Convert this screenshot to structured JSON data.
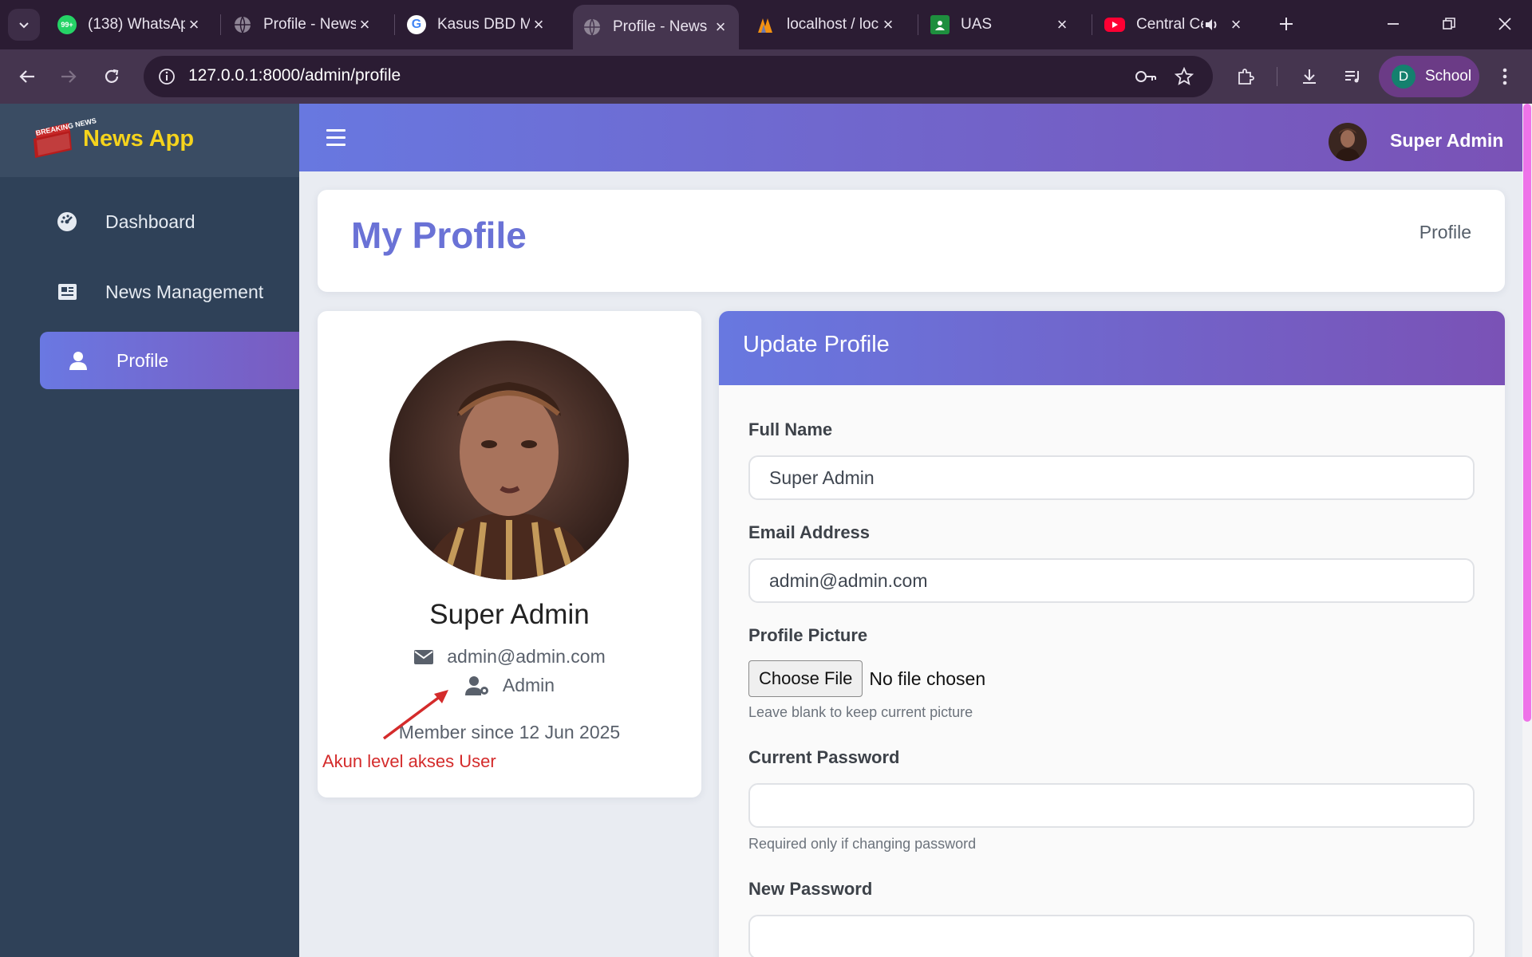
{
  "browser": {
    "tabs": [
      {
        "title": "(138) WhatsAp",
        "favicon": "whatsapp-icon",
        "badge": "99+"
      },
      {
        "title": "Profile - News",
        "favicon": "globe-icon"
      },
      {
        "title": "Kasus DBD Me",
        "favicon": "google-icon"
      },
      {
        "title": "Profile - News",
        "favicon": "globe-icon",
        "active": true
      },
      {
        "title": "localhost / loc",
        "favicon": "phpmyadmin-icon"
      },
      {
        "title": "UAS",
        "favicon": "classroom-icon"
      },
      {
        "title": "Central Ce",
        "favicon": "youtube-icon",
        "audio": true
      }
    ],
    "url": "127.0.0.1:8000/admin/profile",
    "profile": {
      "initial": "D",
      "label": "School"
    }
  },
  "app": {
    "brand": {
      "logo_text": "BREAKING NEWS",
      "name": "News App"
    },
    "nav": [
      {
        "label": "Dashboard",
        "icon": "dashboard-icon"
      },
      {
        "label": "News Management",
        "icon": "newspaper-icon"
      },
      {
        "label": "Profile",
        "icon": "user-icon",
        "active": true
      }
    ],
    "topbar": {
      "user_name": "Super Admin"
    },
    "page": {
      "title": "My Profile",
      "breadcrumb": "Profile"
    },
    "profile_card": {
      "name": "Super Admin",
      "email": "admin@admin.com",
      "role": "Admin",
      "member_since": "Member since 12 Jun 2025",
      "annotation": "Akun level akses User"
    },
    "form": {
      "title": "Update Profile",
      "full_name": {
        "label": "Full Name",
        "value": "Super Admin"
      },
      "email": {
        "label": "Email Address",
        "value": "admin@admin.com"
      },
      "picture": {
        "label": "Profile Picture",
        "button": "Choose File",
        "status": "No file chosen",
        "help": "Leave blank to keep current picture"
      },
      "current_password": {
        "label": "Current Password",
        "value": "",
        "help": "Required only if changing password"
      },
      "new_password": {
        "label": "New Password",
        "value": ""
      }
    }
  },
  "colors": {
    "sidebar": "#2f4158",
    "accent_start": "#6878e0",
    "accent_end": "#7a52b6",
    "brand_yellow": "#f5d31c",
    "annotation_red": "#d42b2b"
  }
}
